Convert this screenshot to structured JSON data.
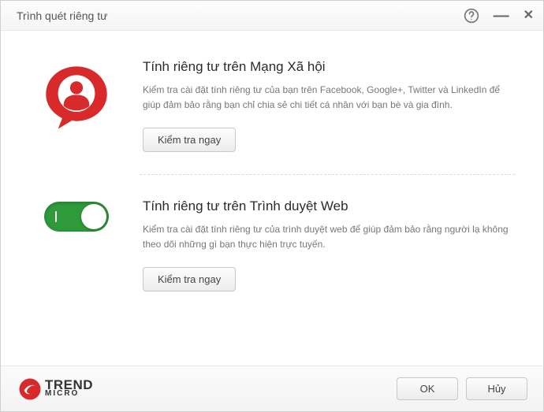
{
  "window": {
    "title": "Trình quét riêng tư"
  },
  "sections": {
    "social": {
      "heading": "Tính riêng tư trên Mạng Xã hội",
      "desc": "Kiểm tra cài đặt tính riêng tư của bạn trên Facebook, Google+, Twitter và LinkedIn để giúp đảm bảo rằng bạn chỉ chia sẻ chi tiết cá nhân với bạn bè và gia đình.",
      "button": "Kiểm tra ngay"
    },
    "browser": {
      "heading": "Tính riêng tư trên Trình duyệt Web",
      "desc": "Kiểm tra cài đặt tính riêng tư của trình duyệt web để giúp đảm bảo rằng người lạ không theo dõi những gì bạn thực hiện trực tuyến.",
      "button": "Kiểm tra ngay"
    }
  },
  "footer": {
    "brand_top": "TREND",
    "brand_bottom": "MICRO",
    "ok": "OK",
    "cancel": "Hủy"
  }
}
